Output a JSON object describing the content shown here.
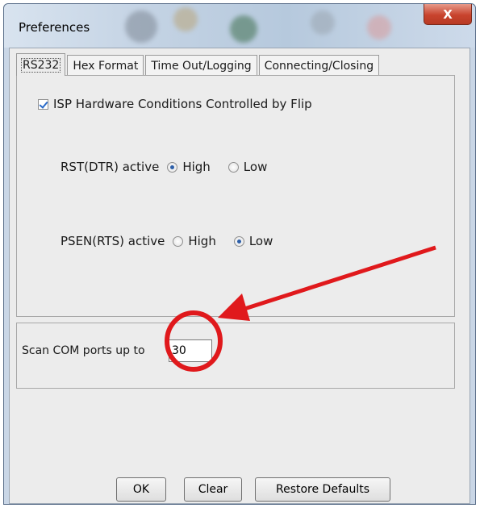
{
  "window": {
    "title": "Preferences",
    "close_glyph": "X"
  },
  "tabs": [
    {
      "label": "RS232",
      "active": true
    },
    {
      "label": "Hex Format",
      "active": false
    },
    {
      "label": "Time Out/Logging",
      "active": false
    },
    {
      "label": "Connecting/Closing",
      "active": false
    }
  ],
  "rs232": {
    "isp_checkbox_label": "ISP Hardware Conditions Controlled by Flip",
    "isp_checked": true,
    "rst_label": "RST(DTR) active",
    "rst_options": [
      "High",
      "Low"
    ],
    "rst_selected": "High",
    "psen_label": "PSEN(RTS) active",
    "psen_options": [
      "High",
      "Low"
    ],
    "psen_selected": "Low"
  },
  "scan": {
    "label": "Scan COM ports up to",
    "value": "30"
  },
  "buttons": {
    "ok": "OK",
    "clear": "Clear",
    "restore": "Restore Defaults"
  },
  "annotation": {
    "color": "#e0191c"
  }
}
